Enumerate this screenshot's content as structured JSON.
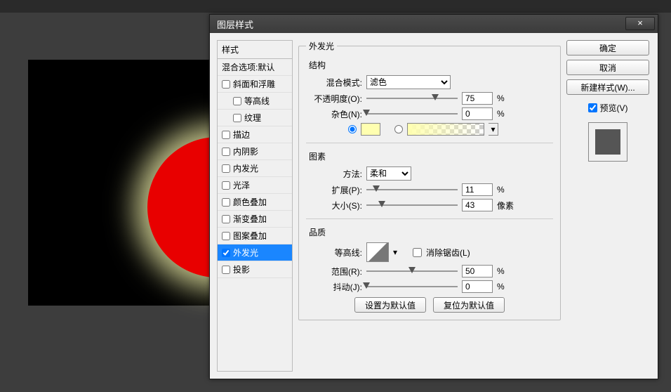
{
  "dialog": {
    "title": "图层样式",
    "close": "×"
  },
  "styles": {
    "header": "样式",
    "blend_options": "混合选项:默认",
    "bevel": "斜面和浮雕",
    "contour": "等高线",
    "texture": "纹理",
    "stroke": "描边",
    "inner_shadow": "内阴影",
    "inner_glow": "内发光",
    "satin": "光泽",
    "color_overlay": "颜色叠加",
    "gradient_overlay": "渐变叠加",
    "pattern_overlay": "图案叠加",
    "outer_glow": "外发光",
    "drop_shadow": "投影"
  },
  "outer_glow": {
    "title": "外发光",
    "structure": "结构",
    "blend_mode_label": "混合模式:",
    "blend_mode_value": "滤色",
    "opacity_label": "不透明度(O):",
    "opacity_value": "75",
    "noise_label": "杂色(N):",
    "noise_value": "0",
    "percent": "%",
    "elements": "图素",
    "technique_label": "方法:",
    "technique_value": "柔和",
    "spread_label": "扩展(P):",
    "spread_value": "11",
    "size_label": "大小(S):",
    "size_value": "43",
    "pixels": "像素",
    "quality": "品质",
    "contour_label": "等高线:",
    "anti_alias": "消除锯齿(L)",
    "range_label": "范围(R):",
    "range_value": "50",
    "jitter_label": "抖动(J):",
    "jitter_value": "0",
    "set_default": "设置为默认值",
    "reset_default": "复位为默认值"
  },
  "buttons": {
    "ok": "确定",
    "cancel": "取消",
    "new_style": "新建样式(W)...",
    "preview": "预览(V)"
  }
}
